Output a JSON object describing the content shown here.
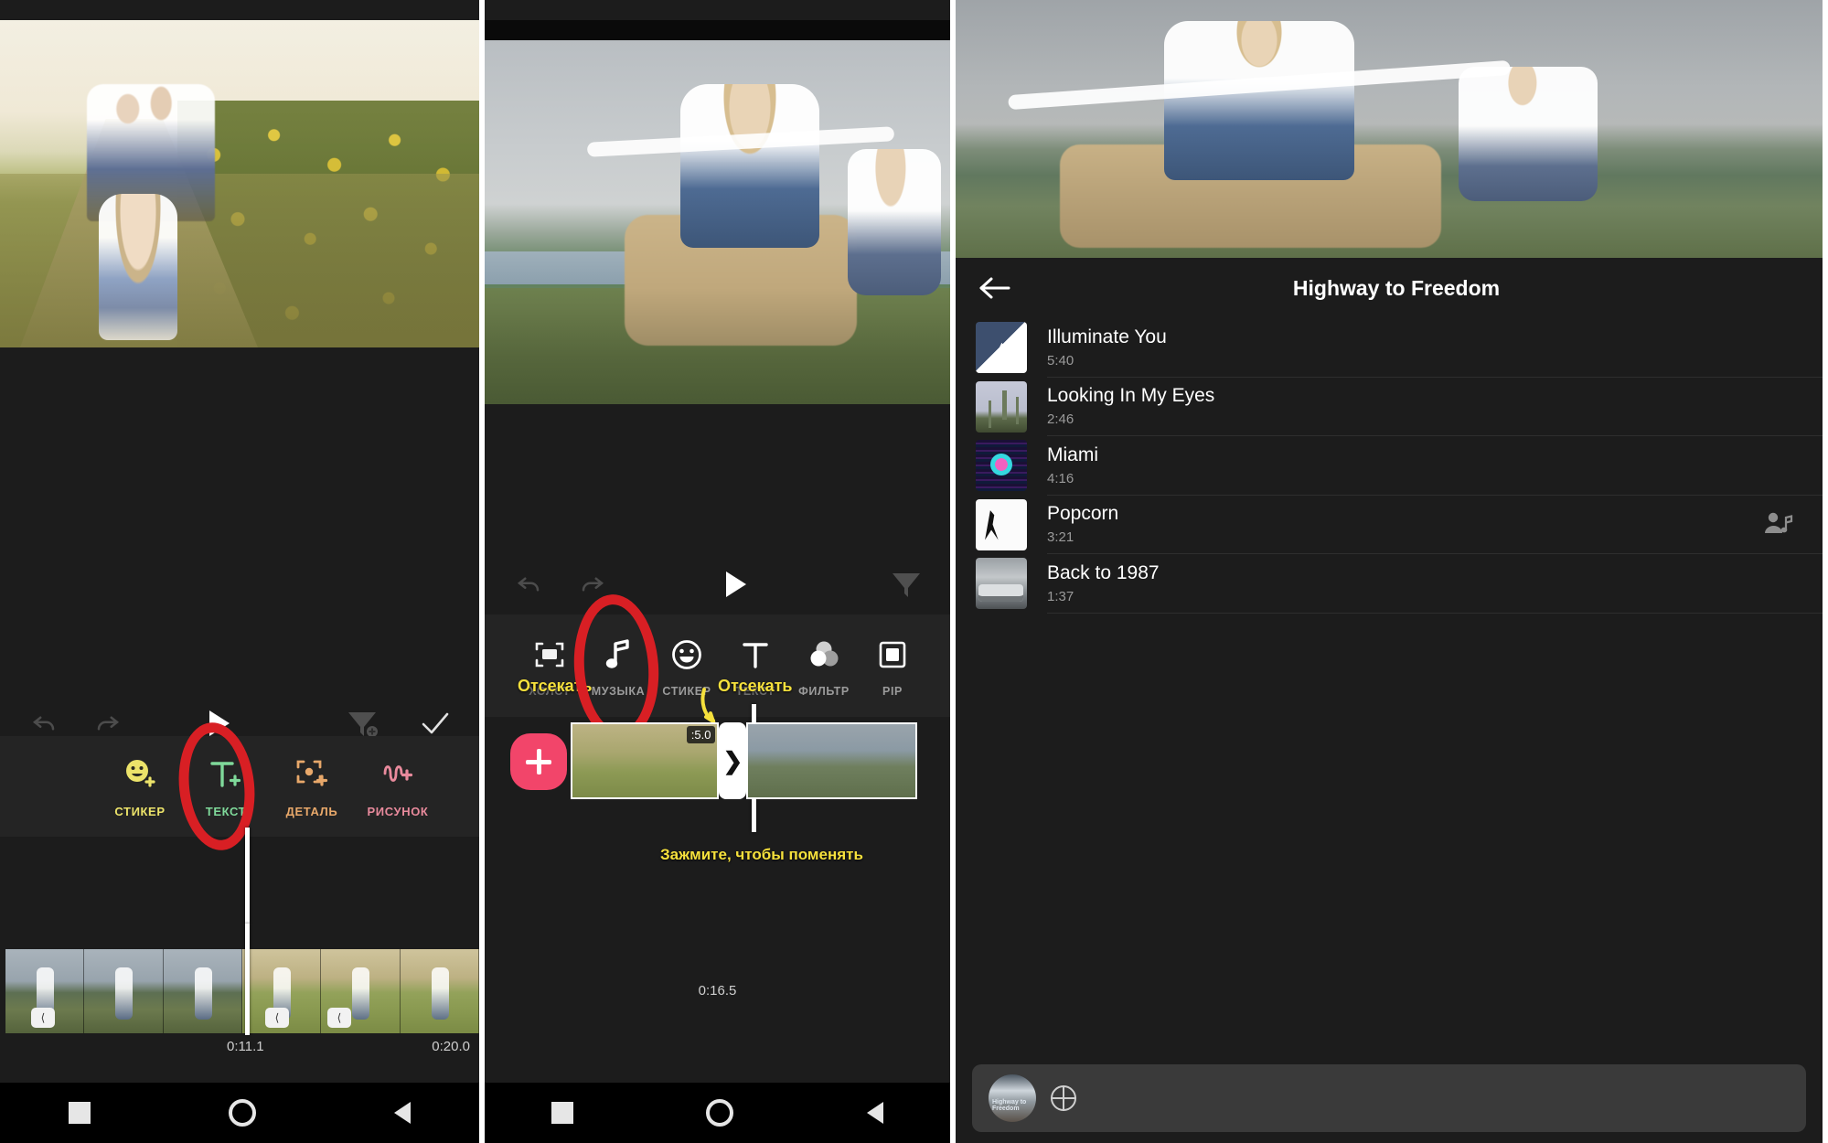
{
  "panel1": {
    "name": "video-editor-text-tool",
    "toolbar": {
      "undo": "undo",
      "redo": "redo",
      "play": "play",
      "export": "export",
      "confirm": "confirm"
    },
    "tools": [
      {
        "label": "СТИКЕР",
        "icon": "sticker-icon",
        "color": "#ece36a"
      },
      {
        "label": "ТЕКСТ",
        "icon": "text-icon",
        "color": "#7fd99a"
      },
      {
        "label": "ДЕТАЛЬ",
        "icon": "detail-icon",
        "color": "#e8a86a"
      },
      {
        "label": "РИСУНОК",
        "icon": "drawing-icon",
        "color": "#e88a9c"
      }
    ],
    "timeline": {
      "current_time": "0:11.1",
      "total_time": "0:20.0"
    },
    "annotation": {
      "type": "red-circle",
      "target": "ТЕКСТ"
    }
  },
  "panel2": {
    "name": "video-editor-music-tool",
    "tools": [
      {
        "label": "ХОЛСТ",
        "icon": "canvas-icon"
      },
      {
        "label": "МУЗЫКА",
        "icon": "music-note-icon"
      },
      {
        "label": "СТИКЕР",
        "icon": "smiley-icon"
      },
      {
        "label": "ТЕКСТ",
        "icon": "text-t-icon"
      },
      {
        "label": "ФИЛЬТР",
        "icon": "filter-circles-icon"
      },
      {
        "label": "PIP",
        "icon": "pip-icon"
      }
    ],
    "annotations": {
      "trim_left": "Отсекать",
      "trim_right": "Отсекать",
      "hold_to_swap": "Зажмите, чтобы поменять"
    },
    "timeline": {
      "add_button": "+",
      "clip_duration_badge": ":5.0",
      "transition": "transition-chevron",
      "current_time": "0:16.5"
    },
    "annotation": {
      "type": "red-circle",
      "target": "МУЗЫКА"
    }
  },
  "panel3": {
    "name": "music-picker",
    "header": {
      "back": "back-arrow",
      "title": "Highway to Freedom"
    },
    "tracks": [
      {
        "title": "Illuminate You",
        "duration": "5:40",
        "art": "art1",
        "has_artist_icon": false
      },
      {
        "title": "Looking In My Eyes",
        "duration": "2:46",
        "art": "art2",
        "has_artist_icon": false
      },
      {
        "title": "Miami",
        "duration": "4:16",
        "art": "art3",
        "has_artist_icon": false
      },
      {
        "title": "Popcorn",
        "duration": "3:21",
        "art": "art4",
        "has_artist_icon": true
      },
      {
        "title": "Back to 1987",
        "duration": "1:37",
        "art": "art5",
        "has_artist_icon": false
      }
    ],
    "miniplayer": {
      "album_caption": "Highway to Freedom",
      "globe": "globe-icon"
    }
  },
  "navbar": {
    "recents": "recents-square",
    "home": "home-circle",
    "back": "back-triangle"
  },
  "colors": {
    "accent_pink": "#f2456a",
    "annotation_red": "#d81f24",
    "annotation_yellow": "#f5e03c",
    "panel_bg": "#1c1c1c",
    "toolbar_bg": "#242424"
  }
}
